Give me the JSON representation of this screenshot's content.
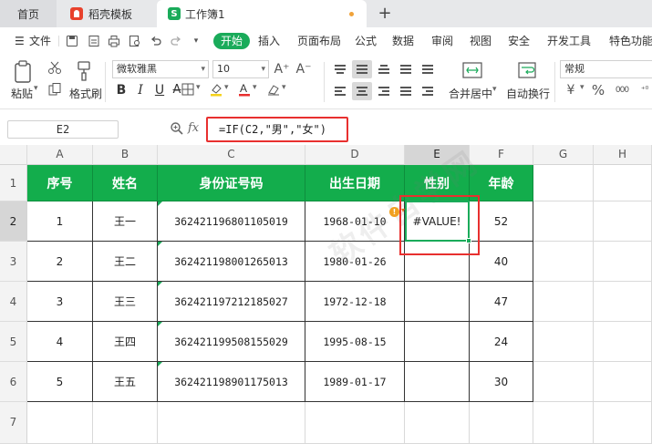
{
  "tabs": {
    "home": "首页",
    "doc": "稻壳模板",
    "active": "工作簿1",
    "active_logo": "S",
    "add": "+"
  },
  "menu": {
    "hamburger": "☰",
    "file": "文件",
    "start": "开始",
    "items": [
      "插入",
      "页面布局",
      "公式",
      "数据",
      "审阅",
      "视图",
      "安全",
      "开发工具",
      "特色功能"
    ]
  },
  "ribbon": {
    "paste": "粘贴",
    "format_painter": "格式刷",
    "font_name": "微软雅黑",
    "font_size": "10",
    "bold": "B",
    "italic": "I",
    "underline": "U",
    "grow_font": "A⁺",
    "shrink_font": "A⁻",
    "merge_center": "合并居中",
    "wrap_text": "自动换行",
    "number_format": "常规",
    "currency": "¥",
    "percent": "%",
    "thousands": "000"
  },
  "formula_bar": {
    "name_box": "E2",
    "fx": "fx",
    "formula": "=IF(C2,\"男\",\"女\")"
  },
  "sheet": {
    "columns": [
      "A",
      "B",
      "C",
      "D",
      "E",
      "F",
      "G",
      "H"
    ],
    "rows": [
      "1",
      "2",
      "3",
      "4",
      "5",
      "6",
      "7"
    ],
    "header": [
      "序号",
      "姓名",
      "身份证号码",
      "出生日期",
      "性别",
      "年龄"
    ],
    "data": [
      {
        "seq": "1",
        "name": "王一",
        "id": "362421196801105019",
        "birth": "1968-01-10",
        "gender": "#VALUE!",
        "age": "52"
      },
      {
        "seq": "2",
        "name": "王二",
        "id": "362421198001265013",
        "birth": "1980-01-26",
        "gender": "",
        "age": "40"
      },
      {
        "seq": "3",
        "name": "王三",
        "id": "362421197212185027",
        "birth": "1972-12-18",
        "gender": "",
        "age": "47"
      },
      {
        "seq": "4",
        "name": "王四",
        "id": "362421199508155029",
        "birth": "1995-08-15",
        "gender": "",
        "age": "24"
      },
      {
        "seq": "5",
        "name": "王五",
        "id": "362421198901175013",
        "birth": "1989-01-17",
        "gender": "",
        "age": "30"
      }
    ]
  },
  "watermark": "软件自学网",
  "colors": {
    "accent": "#1aab5a",
    "header_fill": "#13ad4c",
    "highlight": "#e8302f"
  }
}
